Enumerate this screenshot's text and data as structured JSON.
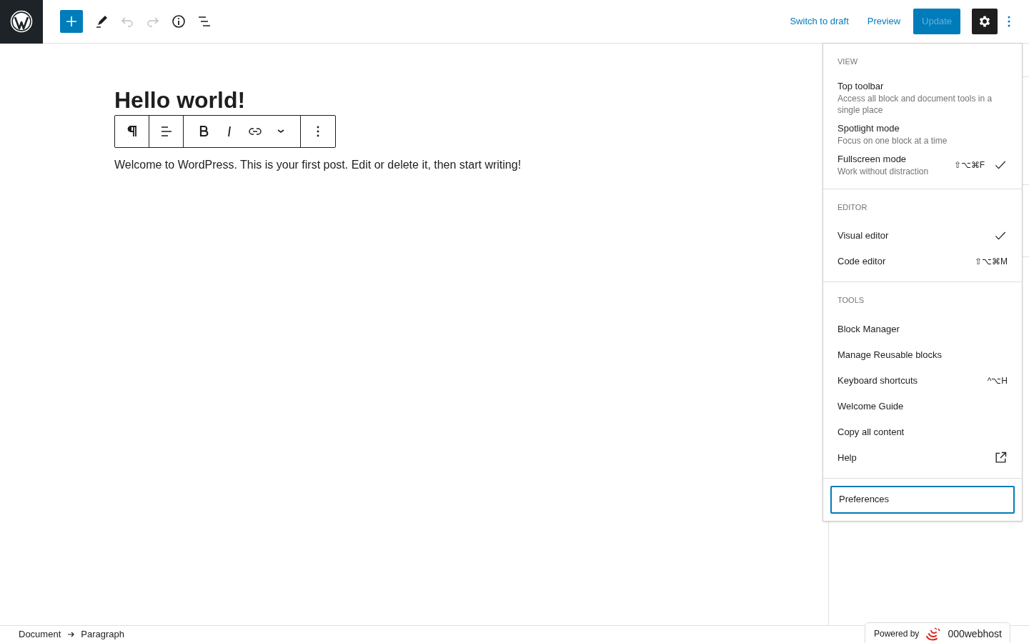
{
  "header": {
    "tools": [
      {
        "kind": "inserter",
        "disabled": false
      },
      {
        "kind": "edit",
        "disabled": false
      },
      {
        "kind": "undo",
        "disabled": true
      },
      {
        "kind": "redo",
        "disabled": true
      },
      {
        "kind": "details",
        "disabled": false
      },
      {
        "kind": "list-view",
        "disabled": false
      }
    ],
    "actions": {
      "switch_to_draft": "Switch to draft",
      "preview": "Preview",
      "update": "Update",
      "update_disabled": true,
      "settings_pressed": true
    }
  },
  "post": {
    "title": "Hello world!",
    "paragraph": "Welcome to WordPress. This is your first post. Edit or delete it, then start writing!"
  },
  "block_toolbar": [
    {
      "kind": "paragraph"
    },
    {
      "kind": "align"
    },
    {
      "kind": "bold"
    },
    {
      "kind": "italic"
    },
    {
      "kind": "link"
    },
    {
      "kind": "more"
    },
    {
      "kind": "options"
    }
  ],
  "menu": {
    "sections": [
      {
        "heading": "VIEW",
        "items": [
          {
            "label": "Top toolbar",
            "description": "Access all block and document tools in a single place",
            "checked": false
          },
          {
            "label": "Spotlight mode",
            "description": "Focus on one block at a time",
            "checked": false
          },
          {
            "label": "Fullscreen mode",
            "description": "Work without distraction",
            "shortcut": "⇧⌥⌘F",
            "checked": true
          }
        ]
      },
      {
        "heading": "EDITOR",
        "items": [
          {
            "label": "Visual editor",
            "checked": true
          },
          {
            "label": "Code editor",
            "shortcut": "⇧⌥⌘M",
            "checked": false
          }
        ]
      },
      {
        "heading": "TOOLS",
        "items": [
          {
            "label": "Block Manager",
            "kind": "plain"
          },
          {
            "label": "Manage Reusable blocks",
            "kind": "plain"
          },
          {
            "label": "Keyboard shortcuts",
            "shortcut": "^⌥H",
            "kind": "plain"
          },
          {
            "label": "Welcome Guide",
            "kind": "plain"
          },
          {
            "label": "Copy all content",
            "kind": "plain"
          },
          {
            "label": "Help",
            "kind": "external"
          }
        ]
      }
    ],
    "preferences": {
      "label": "Preferences",
      "focused": true
    }
  },
  "breadcrumb": [
    "Document",
    "Paragraph"
  ],
  "badge": {
    "prefix": "Powered by",
    "brand": "000webhost"
  }
}
